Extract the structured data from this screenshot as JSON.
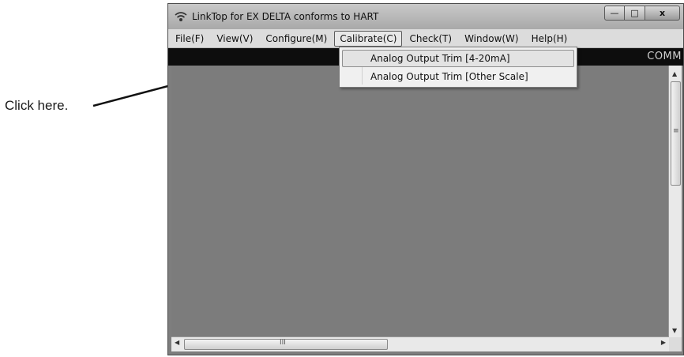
{
  "annotation": {
    "text": "Click here."
  },
  "window": {
    "title": "LinkTop for EX DELTA conforms to HART",
    "controls": {
      "minimize": "—",
      "maximize": "□",
      "close": "x"
    }
  },
  "menubar": {
    "items": [
      "File(F)",
      "View(V)",
      "Configure(M)",
      "Calibrate(C)",
      "Check(T)",
      "Window(W)",
      "Help(H)"
    ],
    "active_index": 3
  },
  "status_strip": {
    "text": "COMM"
  },
  "dropdown": {
    "items": [
      "Analog Output Trim [4-20mA]",
      "Analog Output Trim [Other Scale]"
    ],
    "highlighted_index": 0
  },
  "scrollbar": {
    "grip_vertical": "≡",
    "grip_horizontal": "III",
    "up": "▲",
    "down": "▼",
    "left": "◀",
    "right": "▶"
  },
  "colors": {
    "client_bg": "#7c7c7c",
    "status_strip": "#0d0d0d",
    "menubar_bg": "#dcdcdc"
  },
  "icons": [
    "app-signal-icon",
    "minimize-icon",
    "maximize-icon",
    "close-icon",
    "arrow-pointer"
  ]
}
